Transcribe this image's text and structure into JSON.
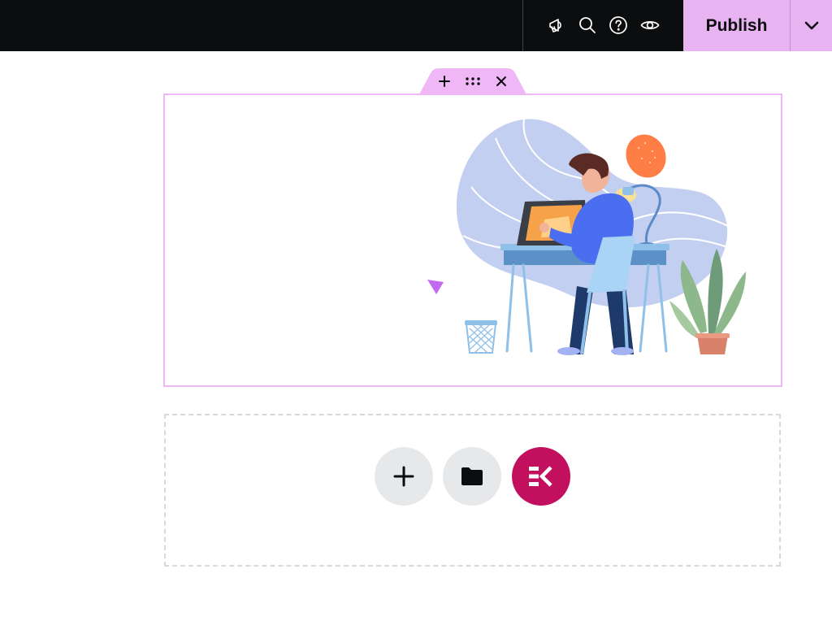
{
  "topbar": {
    "icons": [
      "megaphone-icon",
      "search-icon",
      "help-icon",
      "eye-icon"
    ],
    "publish_label": "Publish",
    "dropdown_icon": "chevron-down-icon"
  },
  "section": {
    "handle_icons": [
      "plus-icon",
      "drag-handle-icon",
      "close-icon"
    ],
    "image": "illustration-man-at-desk"
  },
  "empty_zone": {
    "buttons": [
      "add-section-icon",
      "template-library-icon",
      "elementor-kit-icon"
    ]
  },
  "colors": {
    "topbar_bg": "#0c0d0e",
    "accent": "#e8b3f1",
    "section_border": "#f0b7f7",
    "brand": "#c2105f"
  }
}
